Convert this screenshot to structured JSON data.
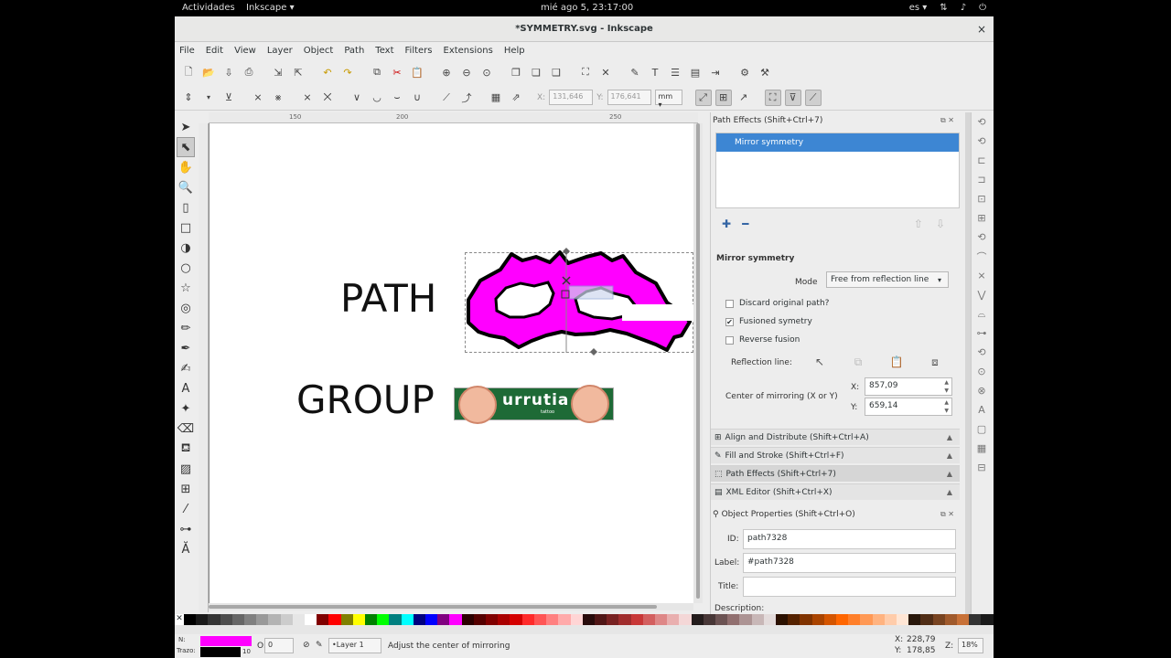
{
  "topbar": {
    "activities": "Actividades",
    "app_name": "Inkscape ▾",
    "clock": "mié ago  5, 23:17:00",
    "lang": "es ▾",
    "tray_icons": [
      "network-icon",
      "volume-icon",
      "power-icon"
    ]
  },
  "window": {
    "title": "*SYMMETRY.svg - Inkscape",
    "close": "×"
  },
  "menu": [
    "File",
    "Edit",
    "View",
    "Layer",
    "Object",
    "Path",
    "Text",
    "Filters",
    "Extensions",
    "Help"
  ],
  "toolbar2": {
    "x_label": "X:",
    "x_value": "131,646",
    "y_label": "Y:",
    "y_value": "176,641",
    "units": "mm ▾"
  },
  "ruler": {
    "ticks": [
      "150",
      "200",
      "250"
    ]
  },
  "canvas": {
    "path_text": "PATH",
    "group_text": "GROUP",
    "logo_text": "urrutia",
    "logo_subtext": "tattoo"
  },
  "dock": {
    "path_effects_title": "Path Effects  (Shift+Ctrl+7)",
    "effects_list": [
      "Mirror symmetry"
    ],
    "effect_name": "Mirror symmetry",
    "mode_label": "Mode",
    "mode_value": "Free from reflection line",
    "discard_label": "Discard original path?",
    "discard_checked": false,
    "fusioned_label": "Fusioned symetry",
    "fusioned_checked": true,
    "reverse_label": "Reverse fusion",
    "reverse_checked": false,
    "reflection_label": "Reflection line:",
    "center_label": "Center of mirroring (X or Y)",
    "x_label": "X:",
    "x_value": "857,09",
    "y_label": "Y:",
    "y_value": "659,14",
    "collapsed": [
      "Align and Distribute (Shift+Ctrl+A)",
      "Fill and Stroke (Shift+Ctrl+F)",
      "Path Effects  (Shift+Ctrl+7)",
      "XML Editor (Shift+Ctrl+X)"
    ],
    "object_props_title": "Object Properties (Shift+Ctrl+O)",
    "id_label": "ID:",
    "id_value": "path7328",
    "label_label": "Label:",
    "label_value": "#path7328",
    "title_label": "Title:",
    "title_value": "",
    "description_label": "Description:"
  },
  "palette_colors": [
    "#000000",
    "#1a1a1a",
    "#333333",
    "#4d4d4d",
    "#666666",
    "#808080",
    "#999999",
    "#b3b3b3",
    "#cccccc",
    "#e6e6e6",
    "#ffffff",
    "#800000",
    "#ff0000",
    "#808000",
    "#ffff00",
    "#008000",
    "#00ff00",
    "#008080",
    "#00ffff",
    "#000080",
    "#0000ff",
    "#800080",
    "#ff00ff",
    "#2b0000",
    "#550000",
    "#800000",
    "#aa0000",
    "#d40000",
    "#ff2a2a",
    "#ff5555",
    "#ff8080",
    "#ffaaaa",
    "#ffd5d5",
    "#280b0b",
    "#501616",
    "#782121",
    "#a02c2c",
    "#c83737",
    "#d35f5f",
    "#de8787",
    "#e9afaf",
    "#f4d7d7",
    "#241c1c",
    "#483737",
    "#6c5353",
    "#916f6f",
    "#ac9393",
    "#c8b7b7",
    "#e3dbdb",
    "#2b1100",
    "#552200",
    "#803300",
    "#aa4400",
    "#d45500",
    "#ff6600",
    "#ff7f2a",
    "#ff9955",
    "#ffb380",
    "#ffccaa",
    "#ffe6d5",
    "#28170b",
    "#502d16",
    "#784421",
    "#a05a2c",
    "#c87137",
    "#333333",
    "#1a1a1a"
  ],
  "status": {
    "fill_label": "N:",
    "stroke_label": "Trazo:",
    "fill_color": "#ff00ff",
    "stroke_color": "#000000",
    "stroke_width": "10",
    "opacity_label": "O:",
    "opacity_value": "0",
    "layer": "•Layer 1",
    "message": "Adjust the center of mirroring",
    "x_label": "X:",
    "x_value": "228,79",
    "y_label": "Y:",
    "y_value": "178,85",
    "zoom_label": "Z:",
    "zoom_value": "18%"
  }
}
